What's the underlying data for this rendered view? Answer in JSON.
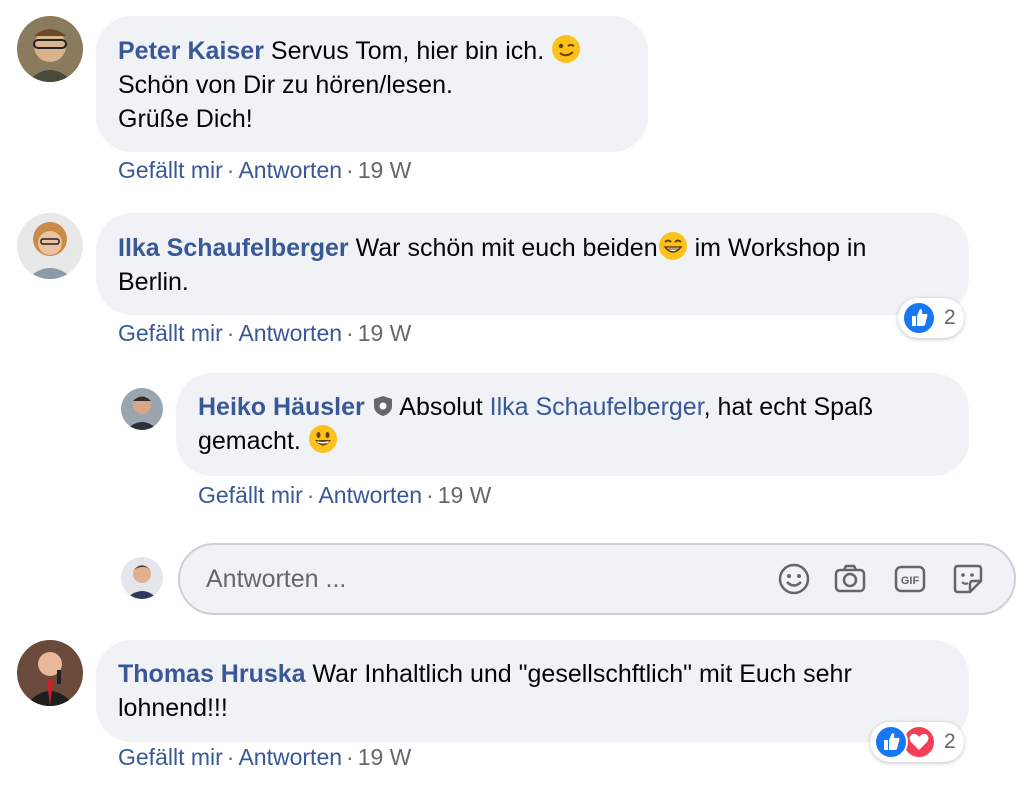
{
  "comments": [
    {
      "author": "Peter Kaiser",
      "lines": [
        "Servus Tom, hier bin ich.",
        "Schön von Dir zu hören/lesen.",
        "Grüße Dich!"
      ],
      "emoji": "wink-emoji",
      "actions": {
        "like": "Gefällt mir",
        "reply": "Antworten",
        "time": "19 W"
      }
    },
    {
      "author": "Ilka Schaufelberger",
      "text_before": "War schön mit euch beiden",
      "emoji": "grin-emoji",
      "text_after": " im Workshop in",
      "line2": "Berlin.",
      "actions": {
        "like": "Gefällt mir",
        "reply": "Antworten",
        "time": "19 W"
      },
      "reactions": {
        "count": "2",
        "types": [
          "like"
        ]
      }
    },
    {
      "author": "Heiko Häusler",
      "badge": "shield-icon",
      "text_before": "Absolut ",
      "mention": "Ilka Schaufelberger",
      "text_after": ", hat echt Spaß",
      "line2": "gemacht.",
      "emoji": "smile-emoji",
      "actions": {
        "like": "Gefällt mir",
        "reply": "Antworten",
        "time": "19 W"
      }
    },
    {
      "author": "Thomas Hruska",
      "text": "War Inhaltlich und \"gesellschftlich\" mit Euch sehr",
      "line2": "lohnend!!!",
      "actions": {
        "like": "Gefällt mir",
        "reply": "Antworten",
        "time": "19 W"
      },
      "reactions": {
        "count": "2",
        "types": [
          "like",
          "love"
        ]
      }
    }
  ],
  "reply_box": {
    "placeholder": "Antworten ...",
    "tools": [
      "emoji-icon",
      "camera-icon",
      "gif-icon",
      "sticker-icon"
    ]
  },
  "colors": {
    "link": "#385898",
    "bubble": "#f0f2f5",
    "meta": "#65676b",
    "like_blue": "#1877f2",
    "love_red": "#f33e58"
  }
}
